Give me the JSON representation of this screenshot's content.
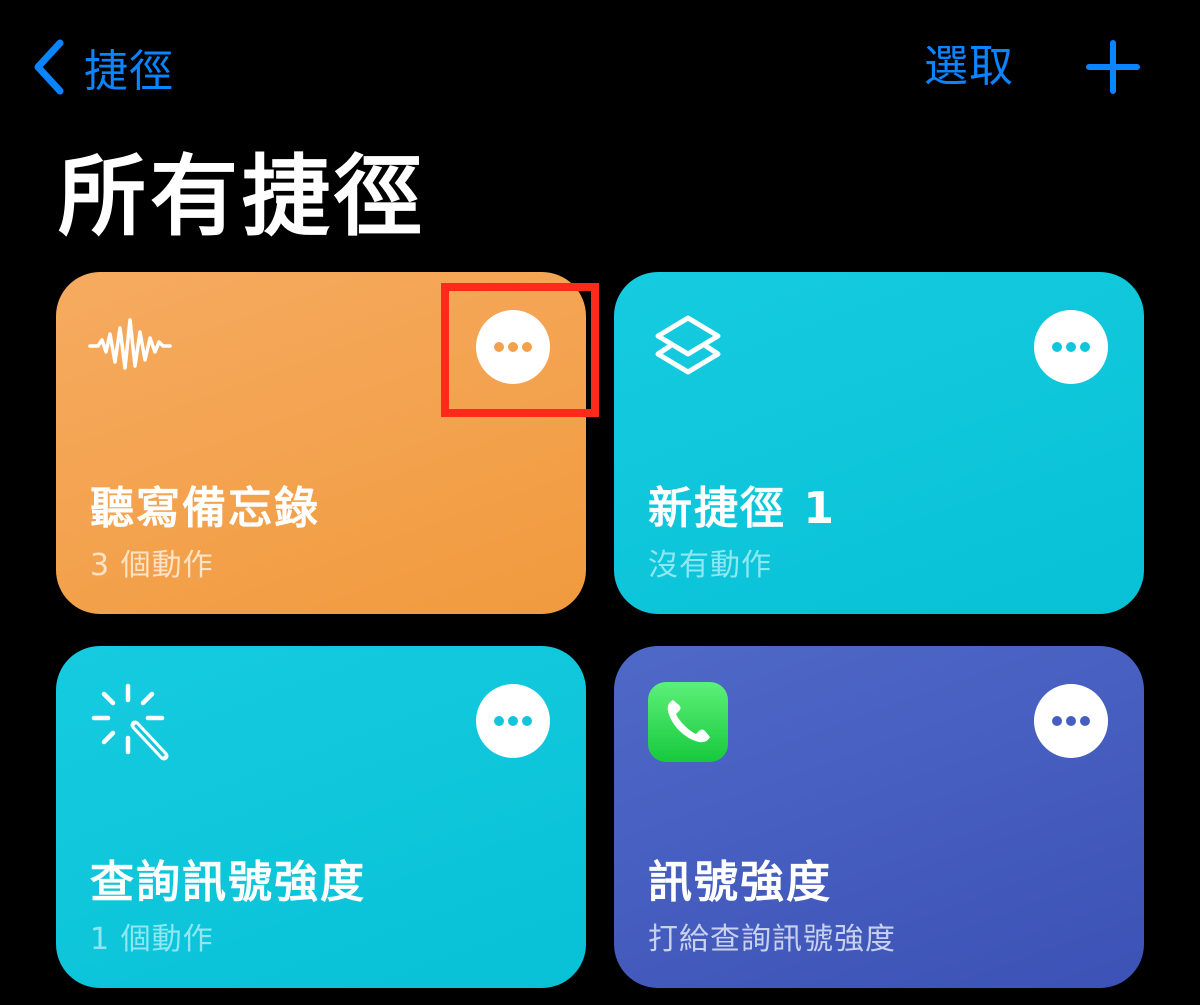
{
  "nav": {
    "back_label": "捷徑",
    "select_label": "選取"
  },
  "page": {
    "title": "所有捷徑"
  },
  "shortcuts": [
    {
      "name": "聽寫備忘錄",
      "subtitle": "3 個動作",
      "icon": "waveform-icon",
      "color": "#f3a24b",
      "subtitle_color": "#fde2c4"
    },
    {
      "name": "新捷徑 1",
      "subtitle": "沒有動作",
      "icon": "stacked-layers-icon",
      "color": "#0fc6dc",
      "subtitle_color": "#8de8f2"
    },
    {
      "name": "查詢訊號強度",
      "subtitle": "1 個動作",
      "icon": "magic-wand-icon",
      "color": "#0fc6dc",
      "subtitle_color": "#8de8f2"
    },
    {
      "name": "訊號強度",
      "subtitle": "打給查詢訊號強度",
      "icon": "phone-app-icon",
      "color": "#455ebf",
      "subtitle_color": "#c9d1f0"
    }
  ],
  "colors": {
    "accent": "#0a84ff",
    "background": "#000000",
    "highlight": "#ff2a1a"
  }
}
